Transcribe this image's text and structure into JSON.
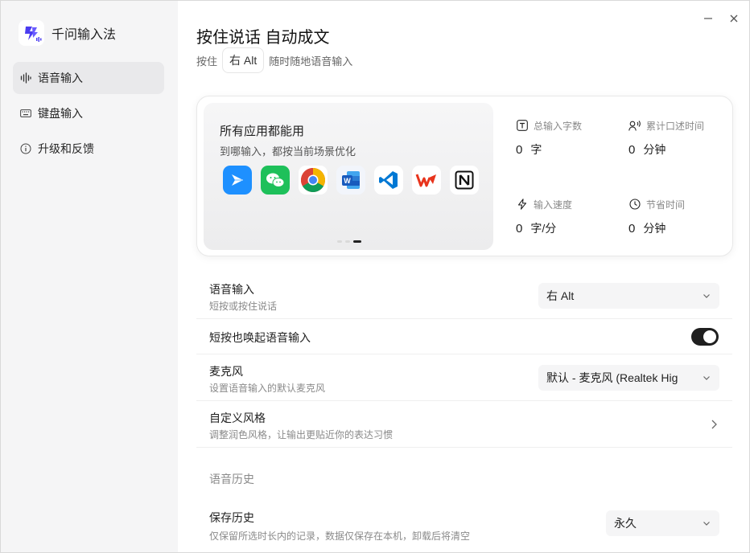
{
  "app": {
    "name": "千问输入法"
  },
  "sidebar": {
    "items": [
      {
        "label": "语音输入",
        "icon": "waveform-icon",
        "active": true
      },
      {
        "label": "键盘输入",
        "icon": "keyboard-icon",
        "active": false
      },
      {
        "label": "升级和反馈",
        "icon": "info-icon",
        "active": false
      }
    ]
  },
  "header": {
    "title": "按住说话 自动成文",
    "sub_prefix": "按住",
    "sub_key": "右 Alt",
    "sub_suffix": "随时随地语音输入"
  },
  "promo": {
    "title": "所有应用都能用",
    "subtitle": "到哪输入，都按当前场景优化",
    "apps": [
      "feishu-icon",
      "wechat-icon",
      "chrome-icon",
      "word-icon",
      "vscode-icon",
      "wps-icon",
      "notion-icon"
    ],
    "carousel": {
      "count": 3,
      "active_index": 2
    }
  },
  "stats": {
    "total_chars": {
      "label": "总输入字数",
      "value": "0",
      "unit": "字"
    },
    "dictation_time": {
      "label": "累计口述时间",
      "value": "0",
      "unit": "分钟"
    },
    "speed": {
      "label": "输入速度",
      "value": "0",
      "unit": "字/分"
    },
    "saved_time": {
      "label": "节省时间",
      "value": "0",
      "unit": "分钟"
    }
  },
  "settings": {
    "voice_input": {
      "label": "语音输入",
      "desc": "短按或按住说话",
      "value": "右 Alt"
    },
    "short_press": {
      "label": "短按也唤起语音输入",
      "enabled": true
    },
    "microphone": {
      "label": "麦克风",
      "desc": "设置语音输入的默认麦克风",
      "value": "默认 - 麦克风 (Realtek Hig"
    },
    "custom_style": {
      "label": "自定义风格",
      "desc": "调整润色风格，让输出更贴近你的表达习惯"
    },
    "history_section": "语音历史",
    "keep_history": {
      "label": "保存历史",
      "desc": "仅保留所选时长内的记录，数据仅保存在本机，卸载后将清空",
      "value": "永久"
    }
  },
  "colors": {
    "accent": "#1f1f1f",
    "sidebar_bg": "#f5f5f6",
    "select_bg": "#f5f5f6"
  }
}
